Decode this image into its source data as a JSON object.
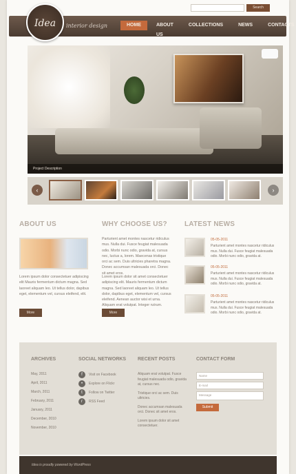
{
  "header": {
    "logo": "Idea",
    "tagline": "interior design",
    "search_button": "Search",
    "nav": [
      "HOME",
      "ABOUT US",
      "COLLECTIONS",
      "NEWS",
      "CONTACTS"
    ]
  },
  "slider": {
    "caption": "Project Description"
  },
  "about": {
    "title": "ABOUT US",
    "text": "Lorem ipsum dolor consectetuer adipiscing elit Mauris fermentum dictum magna. Sed laoreet aliquam leo. Ut tellus dolor, dapibus eget, elementum vel, cursus eleifend, elit.",
    "more": "More"
  },
  "why": {
    "title": "WHY CHOOSE US?",
    "text1": "Parturient amet montes nascetur ridiculus mus. Nulla dui. Fusce feugiat malesuada odio. Morbi nunc odio, gravida at, cursus nec, luctus a, lorem. Maecenas tristique orci ac sem. Duis ultricies pharetra magna. Donec accumsan malesuada orci. Donec sit amet eros.",
    "text2": "Lorem ipsum dolor sit amet consectetuer adipiscing elit. Mauris fermentum dictum magna. Sed laoreet aliquam leo. Ut tellus dolor, dapibus eget, elementum vel, cursus eleifend. Aenean auctor wisi et urna. Aliquam erat volutpat. Integer rutrum.",
    "more": "More"
  },
  "news": {
    "title": "LATEST NEWS",
    "items": [
      {
        "date": "05-05-2011",
        "text": "Parturient amet montes nascetur ridiculus mus. Nulla dui. Fusce feugiat malesuada odio. Morbi nunc odio, gravida at."
      },
      {
        "date": "05-05-2011",
        "text": "Parturient amet montes nascetur ridiculus mus. Nulla dui. Fusce feugiat malesuada odio. Morbi nunc odio, gravida at."
      },
      {
        "date": "05-05-2011",
        "text": "Parturient amet montes nascetur ridiculus mus. Nulla dui. Fusce feugiat malesuada odio. Morbi nunc odio, gravida at."
      }
    ]
  },
  "footer": {
    "archives_title": "ARCHIVES",
    "archives": [
      "May, 2011",
      "April, 2011",
      "March, 2011",
      "February, 2011",
      "January, 2011",
      "December, 2010",
      "November, 2010"
    ],
    "social_title": "SOCIAL NETWORKS",
    "social": [
      {
        "label": "Visit on Facebook",
        "icon": "f"
      },
      {
        "label": "Explore on Flickr",
        "icon": "•"
      },
      {
        "label": "Follow on Twitter",
        "icon": "t"
      },
      {
        "label": "RSS Feed",
        "icon": "r"
      }
    ],
    "recent_title": "RECENT POSTS",
    "recent": [
      "Aliquam erat volutpat. Fusce feugiat malesuada odio, gravida at, cursus nec.",
      "Tristique orci ac sem. Duis ultricies.",
      "Donec accumsan malesuada orci. Donec sit amet eros.",
      "Lorem ipsum dolor sit amet consectetuer."
    ],
    "contact_title": "CONTACT FORM",
    "name_placeholder": "Name",
    "email_placeholder": "E-mail",
    "message_placeholder": "Message",
    "submit": "Submit"
  },
  "copyright": "Idea is proudly powered by WordPress"
}
